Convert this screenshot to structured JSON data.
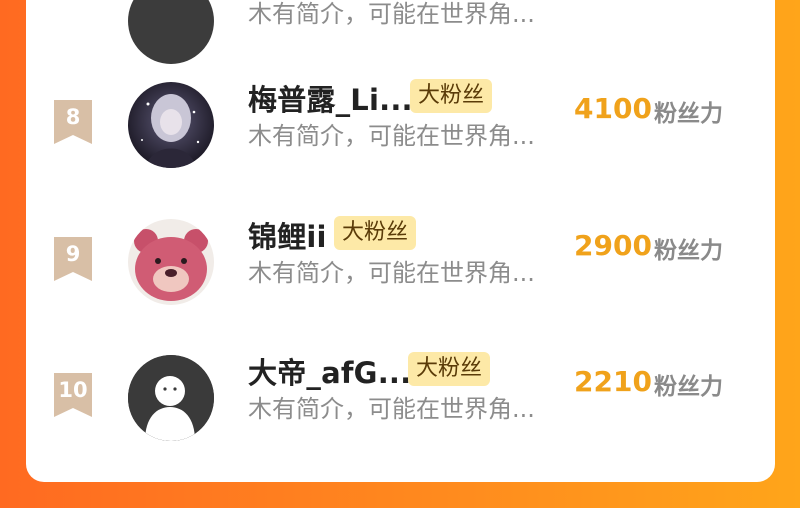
{
  "top_row": {
    "intro": "木有简介，可能在世界角..."
  },
  "rows": [
    {
      "rank": "8",
      "name": "梅普露_Li...",
      "badge": "大粉丝",
      "intro": "木有简介，可能在世界角...",
      "score": "4100",
      "unit": "粉丝力",
      "avatar": "anime-girl"
    },
    {
      "rank": "9",
      "name": "锦鲤ii",
      "badge": "大粉丝",
      "intro": "木有简介，可能在世界角...",
      "score": "2900",
      "unit": "粉丝力",
      "avatar": "pink-bear"
    },
    {
      "rank": "10",
      "name": "大帝_afG...",
      "badge": "大粉丝",
      "intro": "木有简介，可能在世界角...",
      "score": "2210",
      "unit": "粉丝力",
      "avatar": "default-person"
    }
  ],
  "colors": {
    "rank_badge": "#d8bfa6",
    "score": "#f0a21b",
    "badge_bg": "#fde9a7"
  }
}
